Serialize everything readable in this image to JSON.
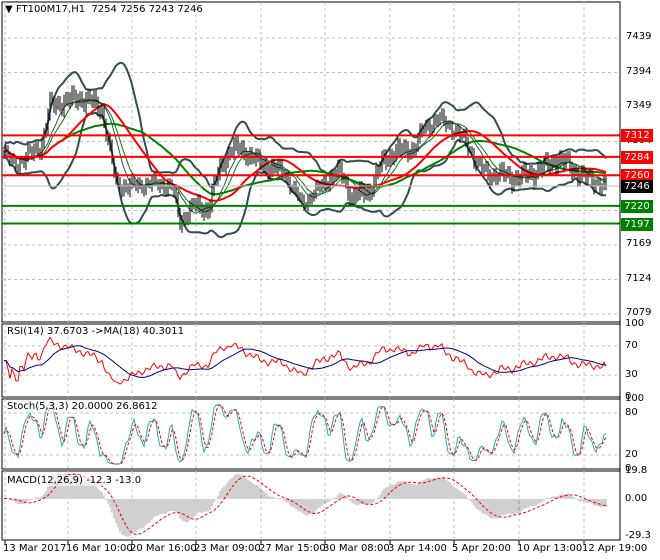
{
  "header": {
    "symbol": "FT100M17,H1",
    "ohlc": "7254 7256 7243 7246"
  },
  "price_axis": [
    "7439",
    "7394",
    "7349",
    "7304",
    "7259",
    "7214",
    "7169",
    "7124",
    "7079"
  ],
  "levels": [
    {
      "label": "7312",
      "value": 7312,
      "color": "#ff0000"
    },
    {
      "label": "7284",
      "value": 7284,
      "color": "#ff0000"
    },
    {
      "label": "7260",
      "value": 7260,
      "color": "#ff0000"
    },
    {
      "label": "7220",
      "value": 7220,
      "color": "#008000"
    },
    {
      "label": "7197",
      "value": 7197,
      "color": "#008000"
    }
  ],
  "current_price": {
    "label": "7246",
    "value": 7246
  },
  "rsi": {
    "title": "RSI(14) 37.6703  ->MA(18) 40.3011",
    "axis": [
      "100",
      "70",
      "30",
      "0"
    ]
  },
  "stoch": {
    "title": "Stoch(5,3,3) 20.0000 26.8612",
    "axis": [
      "100",
      "80",
      "20",
      "0"
    ]
  },
  "macd": {
    "title": "MACD(12,26,9) -12.3 -13.0",
    "axis": [
      "19.8",
      "0.00",
      "-29.3"
    ]
  },
  "time_axis": [
    "13 Mar 2017",
    "16 Mar 10:00",
    "20 Mar 16:00",
    "23 Mar 09:00",
    "27 Mar 15:00",
    "30 Mar 08:00",
    "3 Apr 14:00",
    "5 Apr 20:00",
    "10 Apr 13:00",
    "12 Apr 19:00"
  ],
  "chart_data": {
    "type": "line",
    "title": "FT100M17,H1",
    "ylim": [
      7079,
      7439
    ],
    "x_index": [
      0,
      5,
      12,
      19,
      23,
      30,
      37,
      44,
      49,
      53,
      56,
      62,
      70,
      79,
      84,
      88,
      95,
      102,
      108,
      113,
      118,
      125,
      132,
      140,
      145,
      149,
      156,
      162,
      168,
      174,
      179,
      183,
      190,
      196,
      205,
      210,
      217,
      226,
      232,
      237,
      242,
      248,
      254,
      260,
      265,
      270,
      277,
      282,
      287,
      293,
      298,
      301
    ],
    "close": [
      7290,
      7275,
      7285,
      7300,
      7350,
      7355,
      7360,
      7355,
      7345,
      7290,
      7250,
      7245,
      7250,
      7250,
      7245,
      7200,
      7220,
      7215,
      7270,
      7290,
      7295,
      7280,
      7270,
      7265,
      7240,
      7225,
      7240,
      7255,
      7265,
      7230,
      7235,
      7240,
      7280,
      7290,
      7295,
      7320,
      7335,
      7320,
      7300,
      7275,
      7260,
      7262,
      7255,
      7258,
      7262,
      7270,
      7280,
      7275,
      7262,
      7255,
      7250,
      7246
    ]
  }
}
